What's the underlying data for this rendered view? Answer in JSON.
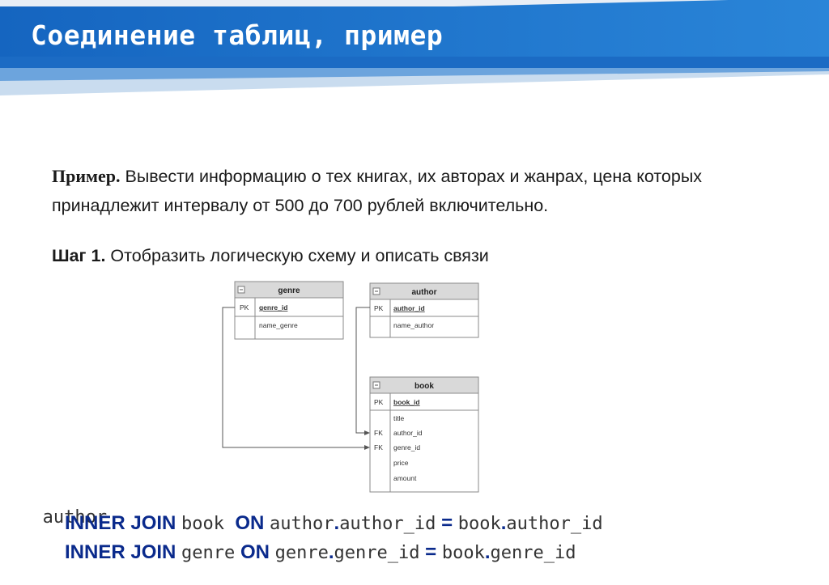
{
  "slide": {
    "title": "Соединение таблиц, пример",
    "task_lead": "Пример.",
    "task_text": " Вывести информацию о тех книгах, их авторах и жанрах, цена которых принадлежит интервалу от 500  до 700 рублей  включительно.",
    "step_lead": "Шаг 1.",
    "step_text": " Отобразить логическую схему и описать связи"
  },
  "diagram": {
    "genre": {
      "name": "genre",
      "pk_label": "PK",
      "pk_field": "genre_id",
      "fields": [
        "name_genre"
      ]
    },
    "author": {
      "name": "author",
      "pk_label": "PK",
      "pk_field": "author_id",
      "fields": [
        "name_author"
      ]
    },
    "book": {
      "name": "book",
      "pk_label": "PK",
      "pk_field": "book_id",
      "fields": [
        {
          "key": "",
          "name": "title"
        },
        {
          "key": "FK",
          "name": "author_id"
        },
        {
          "key": "FK",
          "name": "genre_id"
        },
        {
          "key": "",
          "name": "price"
        },
        {
          "key": "",
          "name": "amount"
        }
      ]
    }
  },
  "sql": {
    "line1": "author",
    "join_kw": "INNER JOIN",
    "on_kw": "ON",
    "eq": "=",
    "dot": ".",
    "l2_table": "book",
    "l2_left_tbl": "author",
    "l2_left_col": "author_id",
    "l2_right_tbl": "book",
    "l2_right_col": "author_id",
    "l3_table": "genre",
    "l3_left_tbl": "genre",
    "l3_left_col": "genre_id",
    "l3_right_tbl": "book",
    "l3_right_col": "genre_id"
  },
  "colors": {
    "header_blue": "#1a73c9",
    "keyword_blue": "#0a2a8c"
  }
}
